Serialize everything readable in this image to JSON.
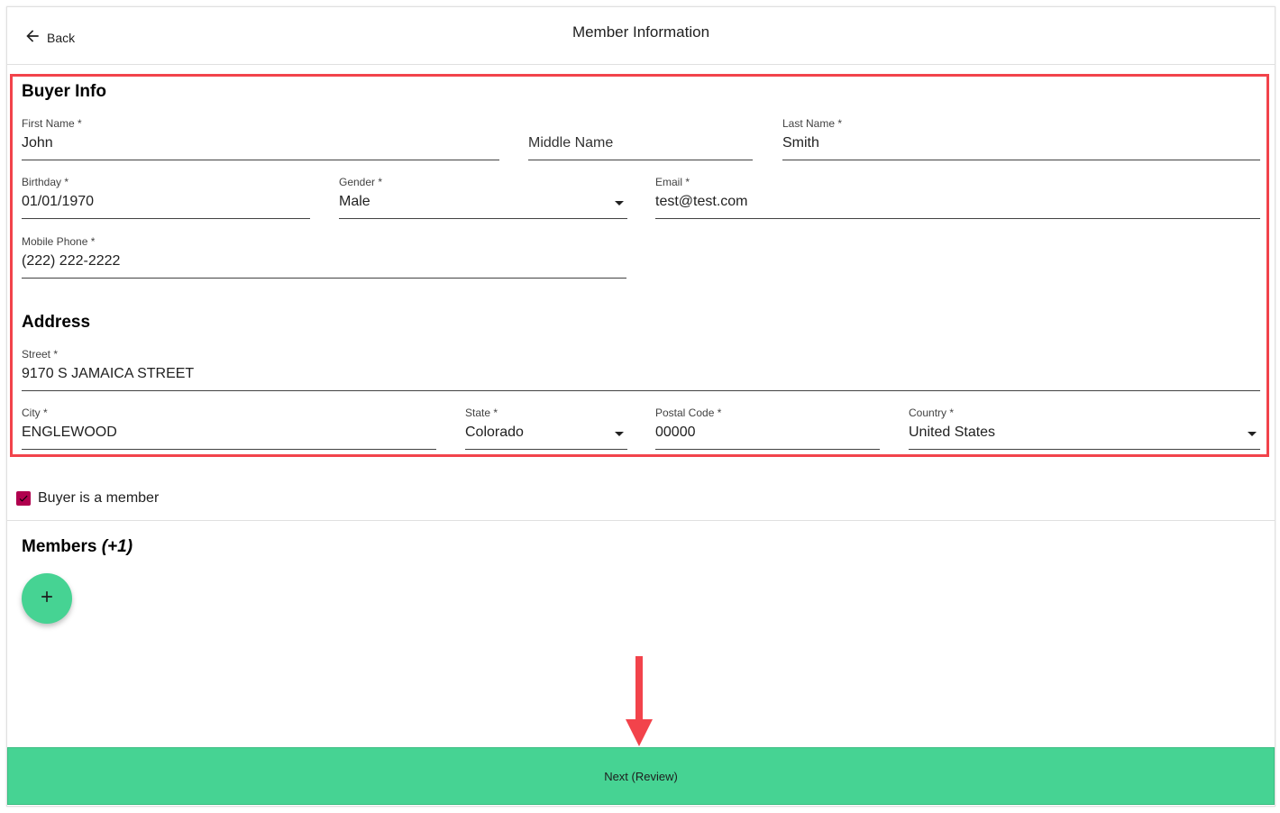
{
  "header": {
    "back_label": "Back",
    "title": "Member Information"
  },
  "buyer_info": {
    "title": "Buyer Info",
    "first_name": {
      "label": "First Name *",
      "value": "John"
    },
    "middle_name": {
      "placeholder": "Middle Name"
    },
    "last_name": {
      "label": "Last Name *",
      "value": "Smith"
    },
    "birthday": {
      "label": "Birthday *",
      "value": "01/01/1970"
    },
    "gender": {
      "label": "Gender *",
      "value": "Male"
    },
    "email": {
      "label": "Email *",
      "value": "test@test.com"
    },
    "mobile_phone": {
      "label": "Mobile Phone *",
      "value": "(222) 222-2222"
    }
  },
  "address": {
    "title": "Address",
    "street": {
      "label": "Street *",
      "value": "9170 S JAMAICA STREET"
    },
    "city": {
      "label": "City *",
      "value": "ENGLEWOOD"
    },
    "state": {
      "label": "State *",
      "value": "Colorado"
    },
    "postal_code": {
      "label": "Postal Code *",
      "value": "00000"
    },
    "country": {
      "label": "Country *",
      "value": "United States"
    }
  },
  "buyer_member": {
    "label": "Buyer is a member",
    "checked": true
  },
  "members": {
    "title": "Members",
    "count": "(+1)"
  },
  "footer": {
    "next_label": "Next (Review)"
  },
  "colors": {
    "accent_green": "#46d393",
    "highlight_red": "#f2434b",
    "checkbox": "#b0004e"
  }
}
